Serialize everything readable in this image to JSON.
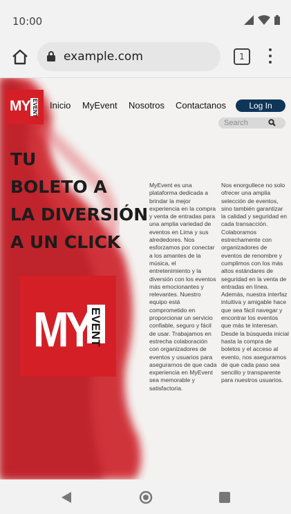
{
  "status_bar": {
    "time": "10:00"
  },
  "browser": {
    "url": "example.com",
    "tab_count": "1"
  },
  "site": {
    "logo_text": "MY",
    "logo_badge": "EVENT",
    "nav": [
      "Inicio",
      "MyEvent",
      "Nosotros",
      "Contactanos"
    ],
    "login_label": "Log In",
    "search_placeholder": "Search",
    "headline": [
      "TU",
      "BOLETO A",
      "LA DIVERSIÓN",
      "A UN CLICK"
    ],
    "column1": "MyEvent es una plataforma dedicada a brindar la mejor experiencia en la compra y venta de entradas para una amplia variedad de eventos en Lima y sus alrededores. Nos esforzamos por conectar a los amantes de la música, el entretenimiento y la diversión con los eventos más emocionantes y relevantes. Nuestro equipo está comprometido en proporcionar un servicio confiable, seguro y fácil de usar. Trabajamos en estrecha colaboración con organizadores de eventos y usuarios para asegurarnos de que cada experiencia en MyEvent sea memorable y satisfactoria.",
    "column2": "Nos enorgullece no solo ofrecer una amplia selección de eventos, sino también garantizar la calidad y seguridad en cada transacción. Colaboramos estrechamente con organizadores de eventos de renombre y cumplimos con los más altos estándares de seguridad en la venta de entradas en línea. Además, nuestra interfaz intuitiva y amigable hace que sea fácil navegar y encontrar los eventos que más te interesan. Desde la búsqueda inicial hasta la compra de boletos y el acceso al evento, nos aseguramos de que cada paso sea sencillo y transparente para nuestros usuarios."
  },
  "colors": {
    "brand_red": "#d41f26",
    "login_button": "#0f3659"
  },
  "icons": [
    "home-icon",
    "lock-icon",
    "tabs-icon",
    "more-vert-icon",
    "search-icon",
    "back-icon",
    "home-nav-icon",
    "recents-icon",
    "signal-icon",
    "wifi-icon",
    "battery-icon"
  ]
}
